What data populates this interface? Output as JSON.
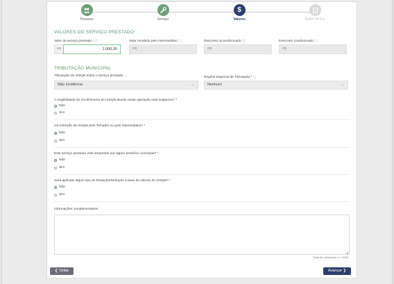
{
  "stepper": {
    "steps": [
      {
        "label": "Pessoas",
        "icon": "people-icon",
        "state": "done"
      },
      {
        "label": "Serviço",
        "icon": "wrench-icon",
        "state": "done"
      },
      {
        "label": "Valores",
        "icon": "dollar-icon",
        "state": "active"
      },
      {
        "label": "Emitir NFS-e",
        "icon": "document-icon",
        "state": "disabled"
      }
    ]
  },
  "valores": {
    "title": "VALORES DO SERVIÇO PRESTADO",
    "valor_servico": {
      "label": "Valor do serviço prestado *",
      "prefix": "R$",
      "value": "1.000,00"
    },
    "valor_intermediario": {
      "label": "Valor recebido pelo intermediário",
      "prefix": "R$"
    },
    "desconto_incondicionado": {
      "label": "Desconto incondicionado",
      "prefix": "R$"
    },
    "desconto_condicionado": {
      "label": "Desconto condicionado",
      "prefix": "R$"
    }
  },
  "tributacao": {
    "title": "TRIBUTAÇÃO MUNICIPAL",
    "issqn": {
      "label": "Tributação do ISSQN sobre o serviço prestado",
      "value": "Não incidência"
    },
    "regime": {
      "label": "Regime Especial de Tributação *",
      "value": "Nenhum"
    }
  },
  "questions": [
    {
      "text": "A exigibilidade do recolhimento do ISSQN devido nesta operação está suspensa? *",
      "options": [
        "Não",
        "Sim"
      ],
      "selected": 0
    },
    {
      "text": "Há retenção do ISSQN pelo Tomador ou pelo intermediário? *",
      "options": [
        "Não",
        "Sim"
      ],
      "selected": 0
    },
    {
      "text": "Este serviço prestado está amparado por algum benefício municipal? *",
      "options": [
        "Não",
        "Sim"
      ],
      "selected": 0
    },
    {
      "text": "Será aplicado algum tipo de Dedução/Redução à base de cálculo do ISSQN? *",
      "options": [
        "Não",
        "Sim"
      ],
      "selected": 0
    }
  ],
  "info": {
    "label": "Informações complementares",
    "counter": "Total de caracteres: 0 / 2000"
  },
  "buttons": {
    "back": "❮ Voltar",
    "next": "Avançar ❯"
  }
}
